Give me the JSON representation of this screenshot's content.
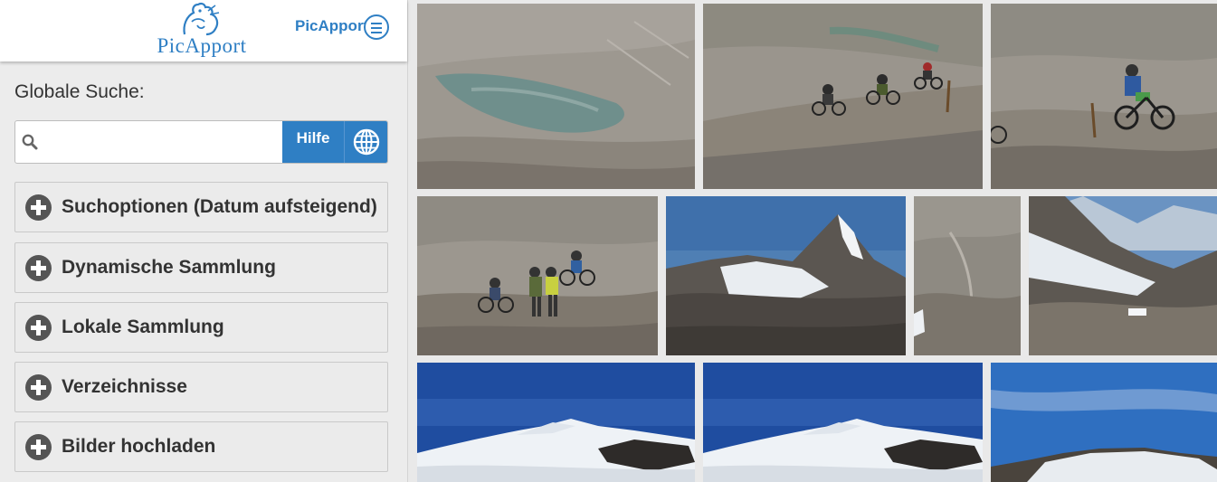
{
  "header": {
    "logo_text": "PicApport",
    "user_link": "PicApport",
    "menu_icon": "hamburger-menu-icon"
  },
  "search": {
    "label": "Globale Suche:",
    "value": "",
    "placeholder": "",
    "help_label": "Hilfe",
    "search_icon": "search-icon",
    "globe_icon": "globe-icon"
  },
  "panels": [
    {
      "label": "Suchoptionen (Datum aufsteigend)",
      "icon": "plus-circle-icon"
    },
    {
      "label": "Dynamische Sammlung",
      "icon": "plus-circle-icon"
    },
    {
      "label": "Lokale Sammlung",
      "icon": "plus-circle-icon"
    },
    {
      "label": "Verzeichnisse",
      "icon": "plus-circle-icon"
    },
    {
      "label": "Bilder hochladen",
      "icon": "plus-circle-icon"
    }
  ],
  "colors": {
    "accent": "#2f7fc4",
    "panel_bg": "#ebebeb",
    "sidebar_bg": "#ececec"
  },
  "gallery": {
    "photos": [
      {
        "scene": "alpine-lake-scree"
      },
      {
        "scene": "mountain-bikers-descent"
      },
      {
        "scene": "mountain-biker-green"
      },
      {
        "scene": "hikers-pushing-bikes"
      },
      {
        "scene": "glacier-peak-blue-sky"
      },
      {
        "scene": "rocky-valley-slope"
      },
      {
        "scene": "snowy-ridge-valley"
      },
      {
        "scene": "snowfield-summit"
      },
      {
        "scene": "snowfield-summit"
      },
      {
        "scene": "glacier-ridge-sky"
      }
    ]
  }
}
